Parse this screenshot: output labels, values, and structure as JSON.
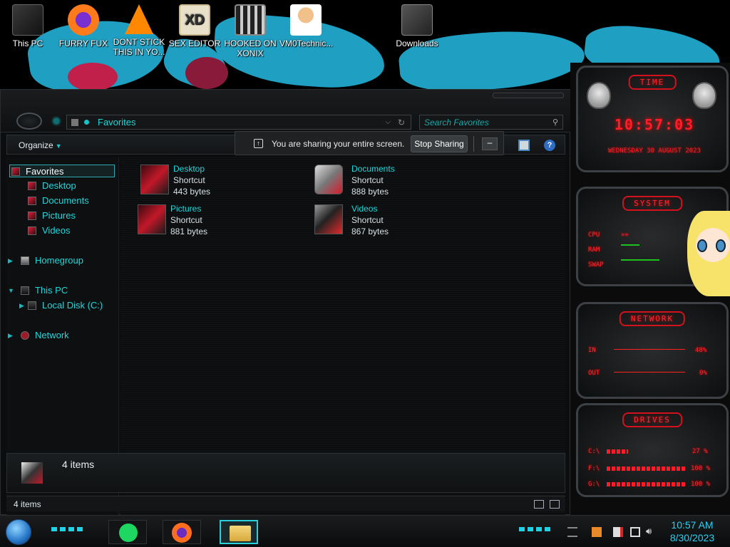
{
  "desktop": {
    "icons": [
      {
        "label": "This PC",
        "icon": "computer-icon"
      },
      {
        "label": "FURRY FUX",
        "icon": "firefox-icon"
      },
      {
        "label": "DONT STICK THIS IN YO...",
        "icon": "vlc-icon"
      },
      {
        "label": "SEX EDITOR",
        "icon": "xd-editor-icon"
      },
      {
        "label": "HOOKED ON XONIX",
        "icon": "game-icon"
      },
      {
        "label": "VM0Technic...",
        "icon": "doctor-icon"
      },
      {
        "label": "Downloads",
        "icon": "downloads-icon"
      }
    ],
    "wallpaper_accent": "#1f9fc2"
  },
  "explorer": {
    "address": "Favorites",
    "search_placeholder": "Search Favorites",
    "toolbar": {
      "organize": "Organize"
    },
    "nav": {
      "favorites": "Favorites",
      "desktop": "Desktop",
      "documents": "Documents",
      "pictures": "Pictures",
      "videos": "Videos",
      "homegroup": "Homegroup",
      "this_pc": "This PC",
      "local_disk": "Local Disk (C:)",
      "network": "Network"
    },
    "files": [
      {
        "name": "Desktop",
        "type": "Shortcut",
        "size": "443 bytes"
      },
      {
        "name": "Documents",
        "type": "Shortcut",
        "size": "888 bytes"
      },
      {
        "name": "Pictures",
        "type": "Shortcut",
        "size": "881 bytes"
      },
      {
        "name": "Videos",
        "type": "Shortcut",
        "size": "867 bytes"
      }
    ],
    "details_count": "4 items",
    "status_count": "4 items",
    "accent": "#1fd8dc"
  },
  "share_bar": {
    "message": "You are sharing your entire screen.",
    "stop_label": "Stop Sharing",
    "minimize_label": "–"
  },
  "gadgets": {
    "time": {
      "title": "TIME",
      "clock": "10:57:03",
      "date": "WEDNESDAY 30 AUGUST 2023"
    },
    "system": {
      "title": "SYSTEM",
      "cpu": "CPU",
      "ram": "RAM",
      "swap": "SWAP"
    },
    "network": {
      "title": "NETWORK",
      "in_label": "IN",
      "in_value": "48%",
      "out_label": "OUT",
      "out_value": "0%"
    },
    "drives": {
      "title": "DRIVES",
      "rows": [
        {
          "label": "C:\\",
          "value": "27 %",
          "fill": 0.27
        },
        {
          "label": "F:\\",
          "value": "100 %",
          "fill": 1.0
        },
        {
          "label": "G:\\",
          "value": "100 %",
          "fill": 1.0
        }
      ]
    },
    "accent": "#ff1d2a"
  },
  "taskbar": {
    "apps": [
      {
        "name": "spotify-icon"
      },
      {
        "name": "firefox-icon"
      },
      {
        "name": "file-explorer-icon"
      }
    ],
    "time": "10:57 AM",
    "date": "8/30/2023"
  }
}
